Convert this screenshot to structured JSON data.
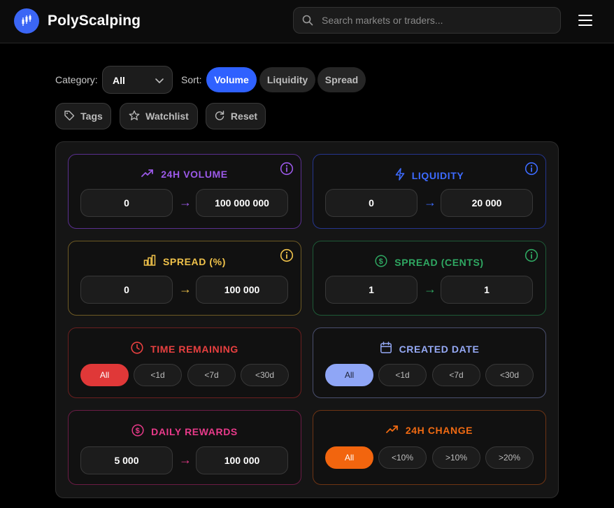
{
  "app": {
    "name": "PolyScalping",
    "search_placeholder": "Search markets or traders..."
  },
  "filters": {
    "category_label": "Category:",
    "category_value": "All",
    "sort_label": "Sort:",
    "sort_options": [
      "Volume",
      "Liquidity",
      "Spread"
    ],
    "sort_active": "Volume",
    "actions": [
      "Tags",
      "Watchlist",
      "Reset"
    ]
  },
  "cards": {
    "volume": {
      "title": "24H VOLUME",
      "min": "0",
      "max": "100 000 000",
      "arrow": "→",
      "color": "#8b4fd6"
    },
    "liquidity": {
      "title": "LIQUIDITY",
      "min": "0",
      "max": "20 000",
      "arrow": "→",
      "color": "#3a66f0"
    },
    "spread_pct": {
      "title": "SPREAD (%)",
      "min": "0",
      "max": "100 000",
      "arrow": "→",
      "color": "#e8b93c"
    },
    "spread_cents": {
      "title": "SPREAD (CENTS)",
      "min": "1",
      "max": "1",
      "arrow": "→",
      "color": "#2e9d5c"
    },
    "time_remaining": {
      "title": "TIME REMAINING",
      "options": [
        "All",
        "<1d",
        "<7d",
        "<30d"
      ],
      "active": "All",
      "color": "#e03a3a"
    },
    "created_date": {
      "title": "CREATED DATE",
      "options": [
        "All",
        "<1d",
        "<7d",
        "<30d"
      ],
      "active": "All",
      "color": "#8fa6f6"
    },
    "daily_rewards": {
      "title": "DAILY REWARDS",
      "min": "5 000",
      "max": "100 000",
      "arrow": "→",
      "color": "#e0307e"
    },
    "change_24h": {
      "title": "24H CHANGE",
      "options": [
        "All",
        "<10%",
        ">10%",
        ">20%"
      ],
      "active": "All",
      "color": "#f06a12"
    }
  },
  "icons": {
    "logo": "candlestick-logo-icon",
    "search": "search-icon",
    "menu": "hamburger-menu-icon",
    "tags": "tag-icon",
    "watchlist": "star-icon",
    "reset": "refresh-icon",
    "volume": "trending-up-icon",
    "liquidity": "lightning-icon",
    "spread_pct": "bar-chart-icon",
    "spread_cents": "dollar-circle-icon",
    "time": "clock-icon",
    "created": "calendar-icon",
    "rewards": "dollar-circle-icon",
    "change": "trending-up-icon",
    "info": "info-icon"
  }
}
